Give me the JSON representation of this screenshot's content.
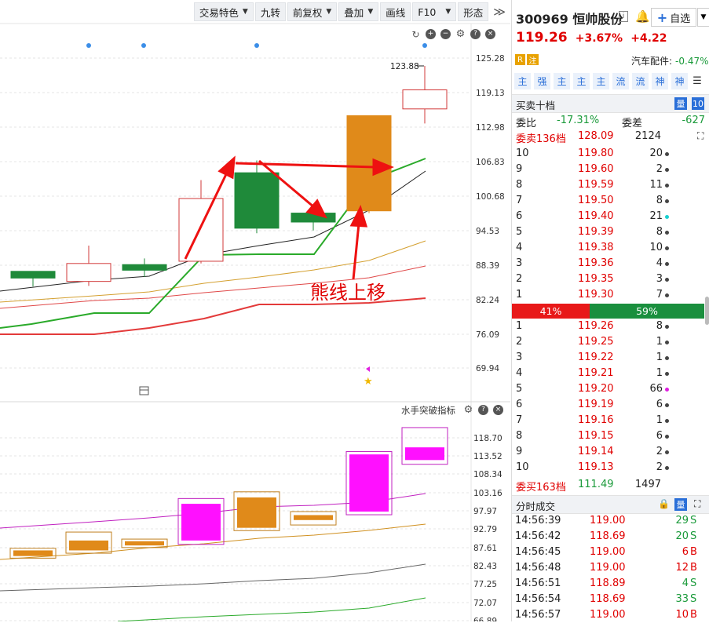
{
  "toolbar": {
    "items": [
      "交易特色",
      "九转",
      "前复权",
      "叠加",
      "画线",
      "F10",
      "形态"
    ]
  },
  "chart": {
    "price_axis": [
      "125.28",
      "119.13",
      "112.98",
      "106.83",
      "100.68",
      "94.53",
      "88.39",
      "82.24",
      "76.09",
      "69.94"
    ],
    "high_label": "123.88",
    "annotation": "熊线上移",
    "sub_title": "水手突破指标",
    "sub_axis": [
      "118.70",
      "113.52",
      "108.34",
      "103.16",
      "97.97",
      "92.79",
      "87.61",
      "82.43",
      "77.25",
      "72.07",
      "66.89"
    ]
  },
  "chart_data": {
    "type": "candlestick",
    "price_axis_range": [
      66.0,
      128.0
    ],
    "candles": [
      {
        "open": 86.0,
        "close": 87.2,
        "high": 87.2,
        "low": 84.5,
        "color": "green"
      },
      {
        "open": 85.4,
        "close": 88.6,
        "high": 91.8,
        "low": 84.6,
        "color": "red"
      },
      {
        "open": 88.4,
        "close": 87.4,
        "high": 89.5,
        "low": 86.2,
        "color": "green"
      },
      {
        "open": 89.0,
        "close": 100.2,
        "high": 103.5,
        "low": 88.6,
        "color": "red"
      },
      {
        "open": 104.8,
        "close": 94.9,
        "high": 107.0,
        "low": 94.0,
        "color": "green"
      },
      {
        "open": 97.6,
        "close": 96.0,
        "high": 98.2,
        "low": 94.5,
        "color": "green"
      },
      {
        "open": 98.0,
        "close": 115.0,
        "high": 115.0,
        "low": 97.6,
        "color": "orange"
      },
      {
        "open": 116.2,
        "close": 119.6,
        "high": 123.88,
        "low": 113.6,
        "color": "red"
      }
    ],
    "sub_boxes": [
      {
        "color": "orange",
        "outer": [
          84.6,
          87.4
        ],
        "inner": [
          85.2,
          86.8
        ]
      },
      {
        "color": "orange",
        "outer": [
          86.0,
          92.0
        ],
        "inner": [
          86.8,
          89.6
        ]
      },
      {
        "color": "orange",
        "outer": [
          87.6,
          90.0
        ],
        "inner": [
          88.2,
          89.4
        ]
      },
      {
        "color": "magenta",
        "outer": [
          88.5,
          101.5
        ],
        "inner": [
          89.6,
          100.0
        ]
      },
      {
        "color": "orange",
        "outer": [
          92.4,
          103.4
        ],
        "inner": [
          93.2,
          101.8
        ]
      },
      {
        "color": "orange",
        "outer": [
          94.0,
          97.8
        ],
        "inner": [
          95.4,
          96.8
        ]
      },
      {
        "color": "magenta",
        "outer": [
          96.9,
          114.8
        ],
        "inner": [
          97.8,
          114.0
        ]
      },
      {
        "color": "magenta",
        "outer": [
          111.2,
          121.6
        ],
        "inner": [
          112.4,
          116.0
        ]
      }
    ]
  },
  "stock": {
    "name": "300969 恒帅股份",
    "watch_label": "自选",
    "price": "119.26",
    "change_pct": "+3.67%",
    "change": "+4.22",
    "tag_r": "R",
    "tag_zhu": "注",
    "sector_name": "汽车配件:",
    "sector_change": "-0.47%"
  },
  "indicator_tabs": [
    "主",
    "强",
    "主",
    "主",
    "主",
    "流",
    "流",
    "神",
    "神"
  ],
  "order_book": {
    "title": "买卖十档",
    "badge_a": "量",
    "badge_b": "10",
    "wei_bi_label": "委比",
    "wei_bi": "-17.31%",
    "wei_cha_label": "委差",
    "wei_cha": "-627",
    "sell_total_label": "委卖136档",
    "sell_total_price": "128.09",
    "sell_total_vol": "2124",
    "sells": [
      {
        "lvl": "10",
        "price": "119.80",
        "vol": "20"
      },
      {
        "lvl": "9",
        "price": "119.60",
        "vol": "2"
      },
      {
        "lvl": "8",
        "price": "119.59",
        "vol": "11"
      },
      {
        "lvl": "7",
        "price": "119.50",
        "vol": "8"
      },
      {
        "lvl": "6",
        "price": "119.40",
        "vol": "21"
      },
      {
        "lvl": "5",
        "price": "119.39",
        "vol": "8"
      },
      {
        "lvl": "4",
        "price": "119.38",
        "vol": "10"
      },
      {
        "lvl": "3",
        "price": "119.36",
        "vol": "4"
      },
      {
        "lvl": "2",
        "price": "119.35",
        "vol": "3"
      },
      {
        "lvl": "1",
        "price": "119.30",
        "vol": "7"
      }
    ],
    "ratio_sell": "41%",
    "ratio_buy": "59%",
    "buys": [
      {
        "lvl": "1",
        "price": "119.26",
        "vol": "8"
      },
      {
        "lvl": "2",
        "price": "119.25",
        "vol": "1"
      },
      {
        "lvl": "3",
        "price": "119.22",
        "vol": "1"
      },
      {
        "lvl": "4",
        "price": "119.21",
        "vol": "1"
      },
      {
        "lvl": "5",
        "price": "119.20",
        "vol": "66"
      },
      {
        "lvl": "6",
        "price": "119.19",
        "vol": "6"
      },
      {
        "lvl": "7",
        "price": "119.16",
        "vol": "1"
      },
      {
        "lvl": "8",
        "price": "119.15",
        "vol": "6"
      },
      {
        "lvl": "9",
        "price": "119.14",
        "vol": "2"
      },
      {
        "lvl": "10",
        "price": "119.13",
        "vol": "2"
      }
    ],
    "buy_total_label": "委买163档",
    "buy_total_price": "111.49",
    "buy_total_vol": "1497"
  },
  "ticks": {
    "title": "分时成交",
    "badge": "量",
    "rows": [
      {
        "time": "14:56:39",
        "price": "119.00",
        "vol": "29",
        "side": "S"
      },
      {
        "time": "14:56:42",
        "price": "118.69",
        "vol": "20",
        "side": "S"
      },
      {
        "time": "14:56:45",
        "price": "119.00",
        "vol": "6",
        "side": "B"
      },
      {
        "time": "14:56:48",
        "price": "119.00",
        "vol": "12",
        "side": "B"
      },
      {
        "time": "14:56:51",
        "price": "118.89",
        "vol": "4",
        "side": "S"
      },
      {
        "time": "14:56:54",
        "price": "118.69",
        "vol": "33",
        "side": "S"
      },
      {
        "time": "14:56:57",
        "price": "119.00",
        "vol": "10",
        "side": "B"
      }
    ]
  }
}
